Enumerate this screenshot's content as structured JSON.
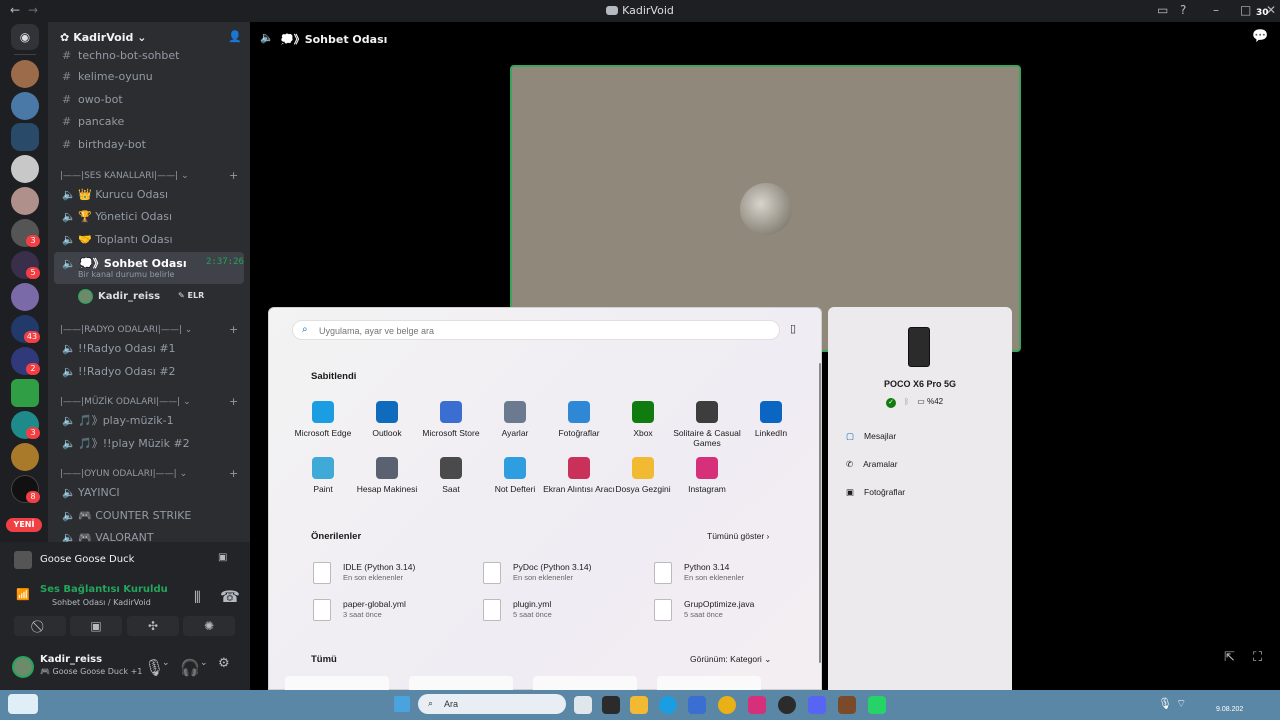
{
  "window": {
    "title": "KadirVoid",
    "badge": "30"
  },
  "server": {
    "name": "KadirVoid"
  },
  "server_badges": [
    "3",
    "5",
    "43",
    "2",
    "3",
    "8"
  ],
  "new_badge": "YENİ",
  "channels": {
    "text": [
      "techno-bot-sohbet",
      "kelime-oyunu",
      "owo-bot",
      "pancake",
      "birthday-bot"
    ],
    "cat_voice": "|——|SES KANALLARI|——|",
    "voice": [
      "👑 Kurucu Odası",
      "🏆 Yönetici Odası",
      "🤝 Toplantı Odası"
    ],
    "active": {
      "name": "💭》Sohbet Odası",
      "timer": "2:37:26",
      "status": "Bir kanal durumu belirle",
      "member": "Kadir_reiss",
      "member_tag": "ELR"
    },
    "cat_radio": "|——|RADYO ODALARI|——|",
    "radio": [
      "!!Radyo Odası #1",
      "!!Radyo Odası #2"
    ],
    "cat_music": "|——|MÜZİK ODALARI|——|",
    "music": [
      "🎵》play-müzik-1",
      "🎵》!!play Müzik #2"
    ],
    "cat_game": "|——|OYUN ODALARI|——|",
    "game": [
      "YAYINCI",
      "🎮 COUNTER STRIKE",
      "🎮 VALORANT"
    ]
  },
  "activity": {
    "name": "Goose Goose Duck"
  },
  "voice_conn": {
    "status": "Ses Bağlantısı Kuruldu",
    "where": "Sohbet Odası / KadirVoid"
  },
  "user": {
    "name": "Kadir_reiss",
    "activity": "Goose Goose Duck +1"
  },
  "header": {
    "channel": "💭》Sohbet Odası"
  },
  "start": {
    "search_placeholder": "Uygulama, ayar ve belge ara",
    "pinned_title": "Sabitlendi",
    "pinned": [
      {
        "label": "Microsoft Edge",
        "color": "#1b9de2"
      },
      {
        "label": "Outlook",
        "color": "#0f6cbd"
      },
      {
        "label": "Microsoft Store",
        "color": "#3a6fd1"
      },
      {
        "label": "Ayarlar",
        "color": "#6b7a8f"
      },
      {
        "label": "Fotoğraflar",
        "color": "#2f88d6"
      },
      {
        "label": "Xbox",
        "color": "#107c10"
      },
      {
        "label": "Solitaire & Casual Games",
        "color": "#3d3d3d"
      },
      {
        "label": "LinkedIn",
        "color": "#0a66c2"
      },
      {
        "label": "Paint",
        "color": "#3fa9d8"
      },
      {
        "label": "Hesap Makinesi",
        "color": "#5a6170"
      },
      {
        "label": "Saat",
        "color": "#4a4a4a"
      },
      {
        "label": "Not Defteri",
        "color": "#2f9ee0"
      },
      {
        "label": "Ekran Alıntısı Aracı",
        "color": "#c9305a"
      },
      {
        "label": "Dosya Gezgini",
        "color": "#f2b933"
      },
      {
        "label": "Instagram",
        "color": "#d6307a"
      }
    ],
    "rec_title": "Önerilenler",
    "show_all": "Tümünü göster",
    "recommended": [
      {
        "name": "IDLE (Python 3.14)",
        "sub": "En son eklenenler"
      },
      {
        "name": "PyDoc (Python 3.14)",
        "sub": "En son eklenenler"
      },
      {
        "name": "Python 3.14",
        "sub": "En son eklenenler"
      },
      {
        "name": "paper-global.yml",
        "sub": "3 saat önce"
      },
      {
        "name": "plugin.yml",
        "sub": "5 saat önce"
      },
      {
        "name": "GrupOptimize.java",
        "sub": "5 saat önce"
      }
    ],
    "all_title": "Tümü",
    "view": "Görünüm: Kategori"
  },
  "phone": {
    "model": "POCO X6 Pro 5G",
    "battery": "%42",
    "items": [
      "Mesajlar",
      "Aramalar",
      "Fotoğraflar"
    ]
  },
  "taskbar": {
    "search": "Ara",
    "clock": "9.08.202"
  }
}
